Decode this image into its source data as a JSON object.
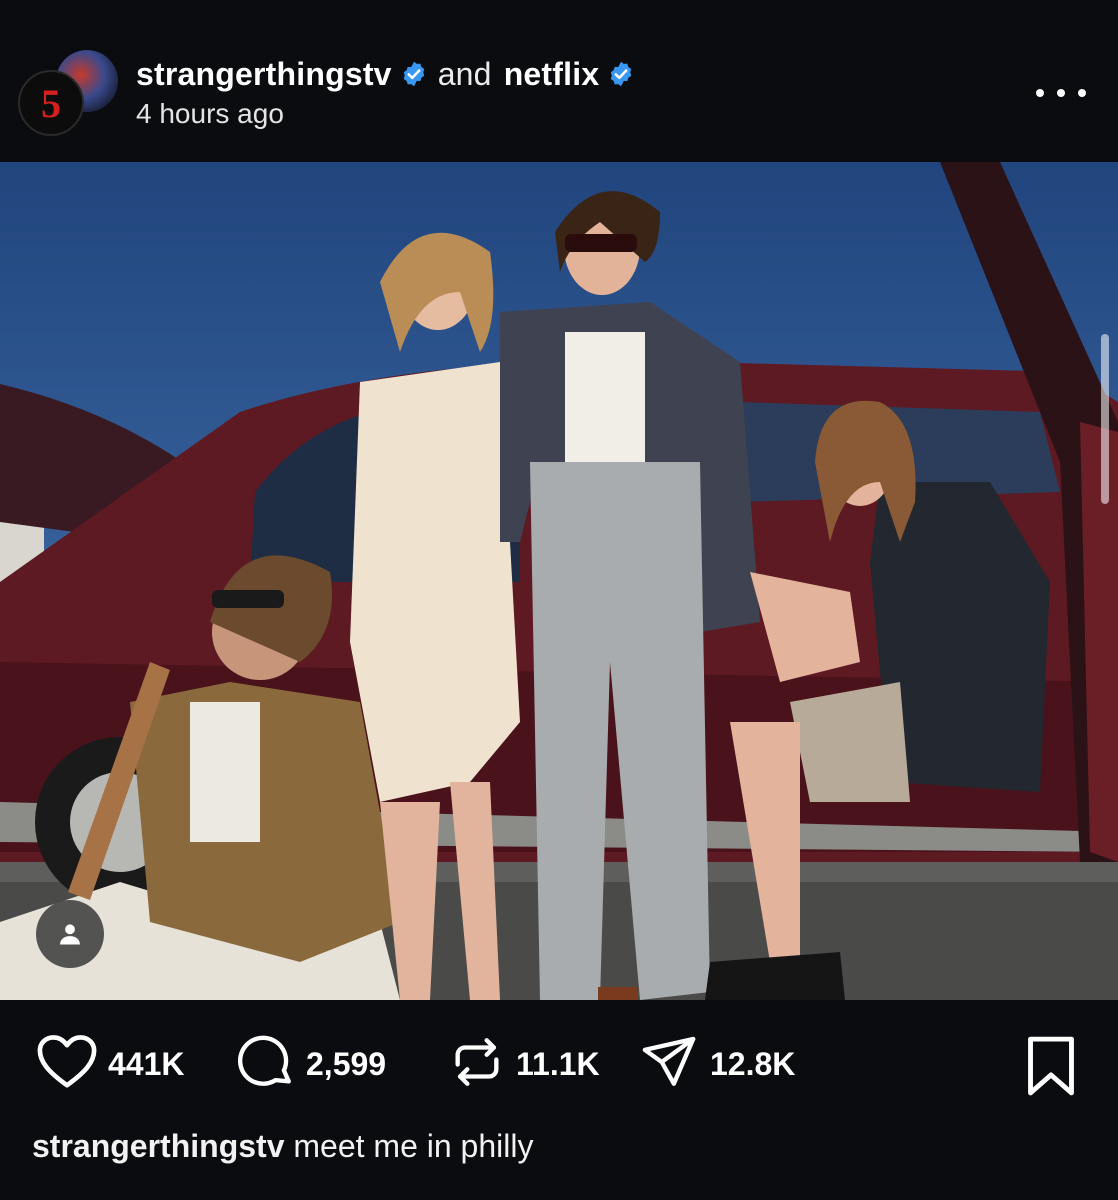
{
  "post": {
    "author_primary": "strangerthingstv",
    "author_joiner": "and",
    "author_secondary": "netflix",
    "timestamp": "4 hours ago",
    "avatar_glyph": "5",
    "verified_color": "#3897f0"
  },
  "actions": {
    "likes": "441K",
    "comments": "2,599",
    "reposts": "11.1K",
    "shares": "12.8K"
  },
  "caption": {
    "handle": "strangerthingstv",
    "text": "meet me in philly"
  },
  "icons": {
    "like": "heart-icon",
    "comment": "comment-bubble-icon",
    "repost": "repost-icon",
    "share": "send-icon",
    "save": "bookmark-icon",
    "more": "more-dots-icon",
    "tag": "user-tag-icon"
  }
}
